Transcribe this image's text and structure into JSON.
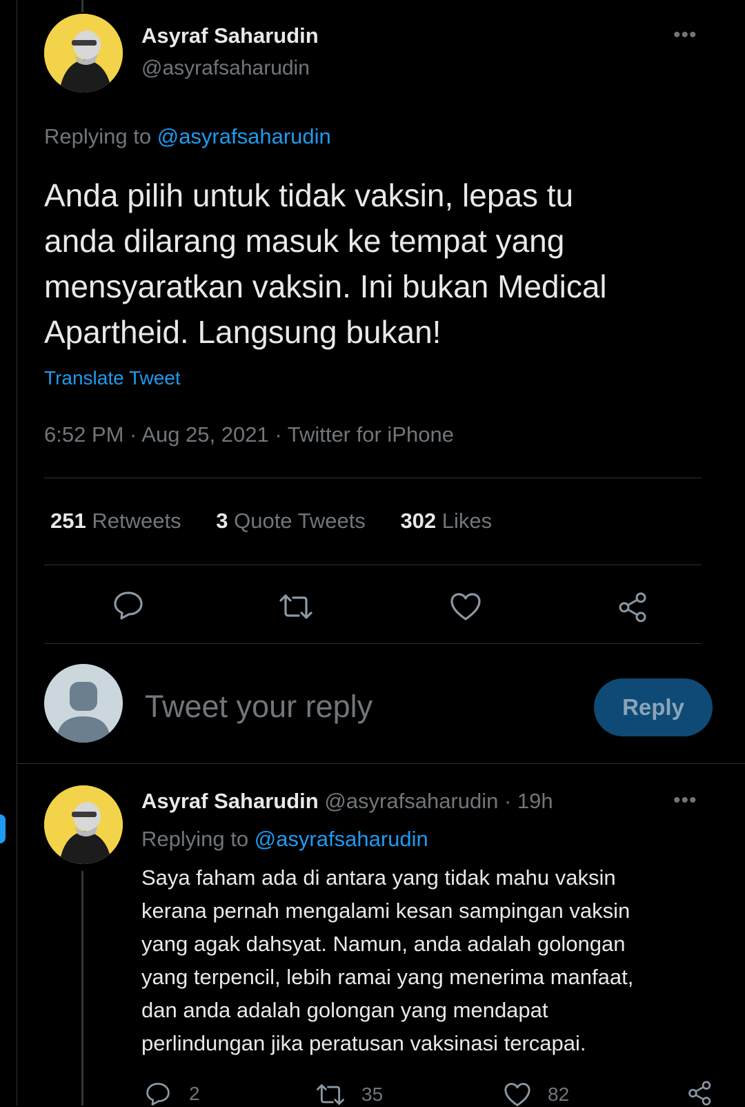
{
  "main_tweet": {
    "name": "Asyraf Saharudin",
    "handle": "@asyrafsaharudin",
    "more": "•••",
    "replying_prefix": "Replying to",
    "replying_to": "@asyrafsaharudin",
    "text_lines": [
      "Anda pilih untuk tidak vaksin, lepas tu",
      "anda dilarang masuk ke tempat yang",
      "mensyaratkan vaksin. Ini bukan Medical",
      "Apartheid. Langsung bukan!"
    ],
    "translate": "Translate Tweet",
    "meta": "6:52 PM · Aug 25, 2021 · Twitter for iPhone",
    "stats": {
      "retweets_count": "251",
      "retweets_label": "Retweets",
      "quotes_count": "3",
      "quotes_label": "Quote Tweets",
      "likes_count": "302",
      "likes_label": "Likes"
    },
    "actions": [
      "reply-icon",
      "retweet-icon",
      "like-icon",
      "share-icon"
    ]
  },
  "composer": {
    "placeholder": "Tweet your reply",
    "button_label": "Reply"
  },
  "reply_tweet": {
    "name": "Asyraf Saharudin",
    "handle": "@asyrafsaharudin",
    "time": "· 19h",
    "more": "•••",
    "replying_prefix": "Replying to",
    "replying_to": "@asyrafsaharudin",
    "text_lines": [
      "Saya faham ada di antara yang tidak mahu vaksin",
      "kerana pernah mengalami kesan sampingan vaksin",
      "yang agak dahsyat. Namun, anda adalah golongan",
      "yang terpencil, lebih ramai yang menerima manfaat,",
      "dan anda adalah golongan yang mendapat",
      "perlindungan jika peratusan vaksinasi tercapai."
    ],
    "counts": {
      "replies": "2",
      "retweets": "35",
      "likes": "82"
    }
  },
  "colors": {
    "background": "#000000",
    "text": "#e7e9ea",
    "muted": "#71767b",
    "link": "#1d9bf0",
    "avatar_bg": "#f3d34a",
    "reply_button": "#0e4a75"
  }
}
